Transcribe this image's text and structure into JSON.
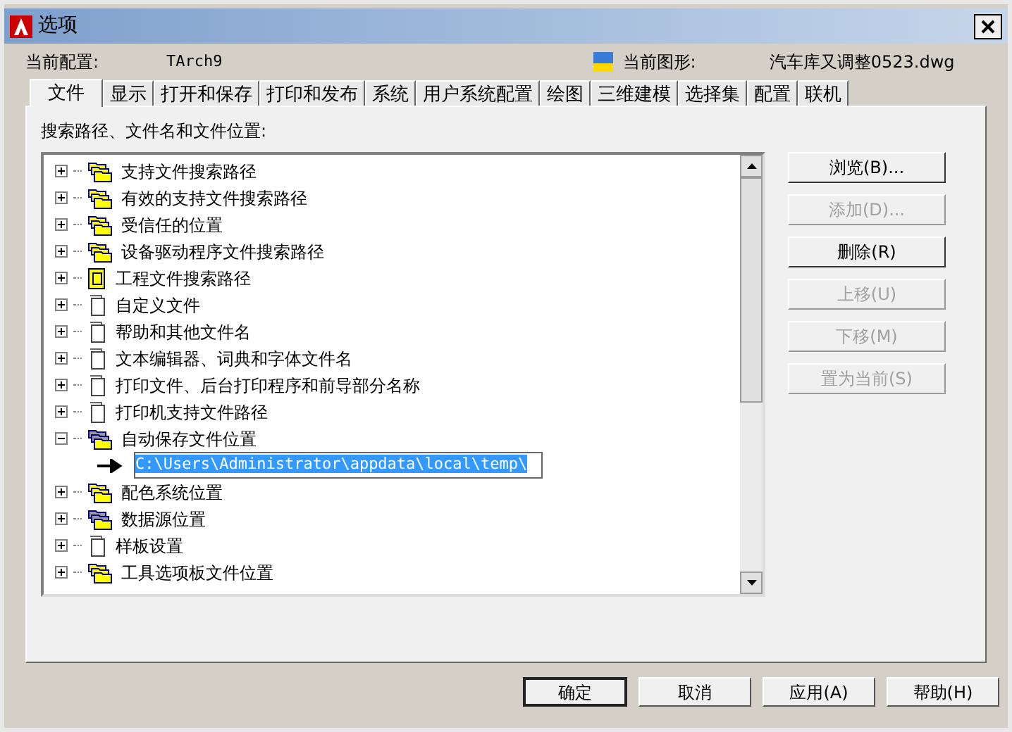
{
  "window": {
    "title": "选项"
  },
  "header": {
    "profile_label": "当前配置:",
    "profile_value": "TArch9",
    "drawing_label": "当前图形:",
    "drawing_value": "汽车库又调整0523.dwg"
  },
  "tabs": [
    {
      "label": "文件",
      "selected": true
    },
    {
      "label": "显示",
      "selected": false
    },
    {
      "label": "打开和保存",
      "selected": false
    },
    {
      "label": "打印和发布",
      "selected": false
    },
    {
      "label": "系统",
      "selected": false
    },
    {
      "label": "用户系统配置",
      "selected": false
    },
    {
      "label": "绘图",
      "selected": false
    },
    {
      "label": "三维建模",
      "selected": false
    },
    {
      "label": "选择集",
      "selected": false
    },
    {
      "label": "配置",
      "selected": false
    },
    {
      "label": "联机",
      "selected": false
    }
  ],
  "tree_label": "搜索路径、文件名和文件位置:",
  "tree": [
    {
      "label": "支持文件搜索路径",
      "kind": "folders",
      "expanded": false
    },
    {
      "label": "有效的支持文件搜索路径",
      "kind": "folders",
      "expanded": false
    },
    {
      "label": "受信任的位置",
      "kind": "folders",
      "expanded": false
    },
    {
      "label": "设备驱动程序文件搜索路径",
      "kind": "folders",
      "expanded": false
    },
    {
      "label": "工程文件搜索路径",
      "kind": "project",
      "expanded": false
    },
    {
      "label": "自定义文件",
      "kind": "file",
      "expanded": false
    },
    {
      "label": "帮助和其他文件名",
      "kind": "file",
      "expanded": false
    },
    {
      "label": "文本编辑器、词典和字体文件名",
      "kind": "file",
      "expanded": false
    },
    {
      "label": "打印文件、后台打印程序和前导部分名称",
      "kind": "file",
      "expanded": false
    },
    {
      "label": "打印机支持文件路径",
      "kind": "file",
      "expanded": false
    },
    {
      "label": "自动保存文件位置",
      "kind": "folder-gray",
      "expanded": true,
      "children": [
        {
          "label": "C:\\Users\\Administrator\\appdata\\local\\temp\\",
          "selected": true
        }
      ]
    },
    {
      "label": "配色系统位置",
      "kind": "folders",
      "expanded": false
    },
    {
      "label": "数据源位置",
      "kind": "folder-gray",
      "expanded": false
    },
    {
      "label": "样板设置",
      "kind": "file",
      "expanded": false
    },
    {
      "label": "工具选项板文件位置",
      "kind": "folders",
      "expanded": false
    }
  ],
  "side_buttons": [
    {
      "label": "浏览(B)...",
      "disabled": false
    },
    {
      "label": "添加(D)...",
      "disabled": true
    },
    {
      "label": "删除(R)",
      "disabled": false
    },
    {
      "label": "上移(U)",
      "disabled": true
    },
    {
      "label": "下移(M)",
      "disabled": true
    },
    {
      "label": "置为当前(S)",
      "disabled": true
    }
  ],
  "footer_buttons": [
    {
      "label": "确定",
      "default": true
    },
    {
      "label": "取消",
      "default": false
    },
    {
      "label": "应用(A)",
      "default": false
    },
    {
      "label": "帮助(H)",
      "default": false
    }
  ]
}
